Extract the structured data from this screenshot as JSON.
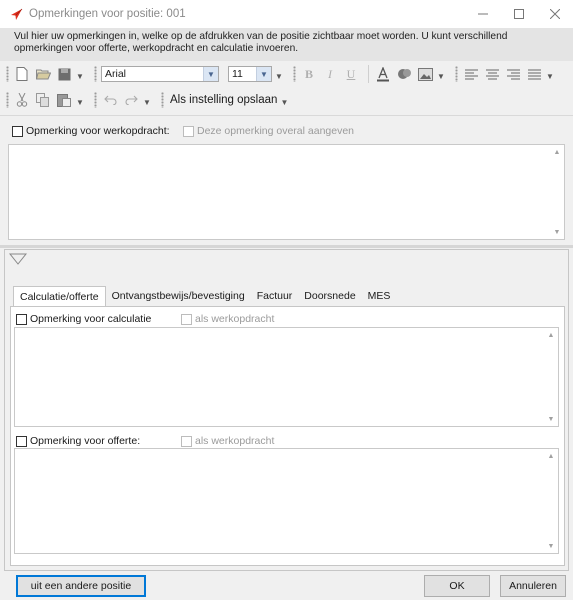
{
  "window": {
    "title": "Opmerkingen voor positie: 001",
    "minimize": "—",
    "maximize": "☐",
    "close": "✕"
  },
  "info_text": "Vul hier uw opmerkingen in, welke op de afdrukken van de positie zichtbaar moet worden. U kunt verschillend opmerkingen voor offerte, werkopdracht en calculatie invoeren.",
  "toolbar": {
    "font_name": "Arial",
    "font_size": "11",
    "bold": "B",
    "italic": "I",
    "underline": "U",
    "save_setting_label": "Als instelling opslaan"
  },
  "work_order": {
    "checkbox_label": "Opmerking voor werkopdracht:",
    "everywhere_label": "Deze opmerking overal aangeven",
    "text": ""
  },
  "tabs": [
    {
      "label": "Calculatie/offerte"
    },
    {
      "label": "Ontvangstbewijs/bevestiging"
    },
    {
      "label": "Factuur"
    },
    {
      "label": "Doorsnede"
    },
    {
      "label": "MES"
    }
  ],
  "calc_panel": {
    "calc_label": "Opmerking voor calculatie",
    "calc_as_work_label": "als werkopdracht",
    "offer_label": "Opmerking voor offerte:",
    "offer_as_work_label": "als werkopdracht"
  },
  "buttons": {
    "other_position": "uit een andere positie",
    "ok": "OK",
    "cancel": "Annuleren"
  },
  "colors": {
    "app_icon": "#e0301e",
    "focus_border": "#0078d7"
  }
}
